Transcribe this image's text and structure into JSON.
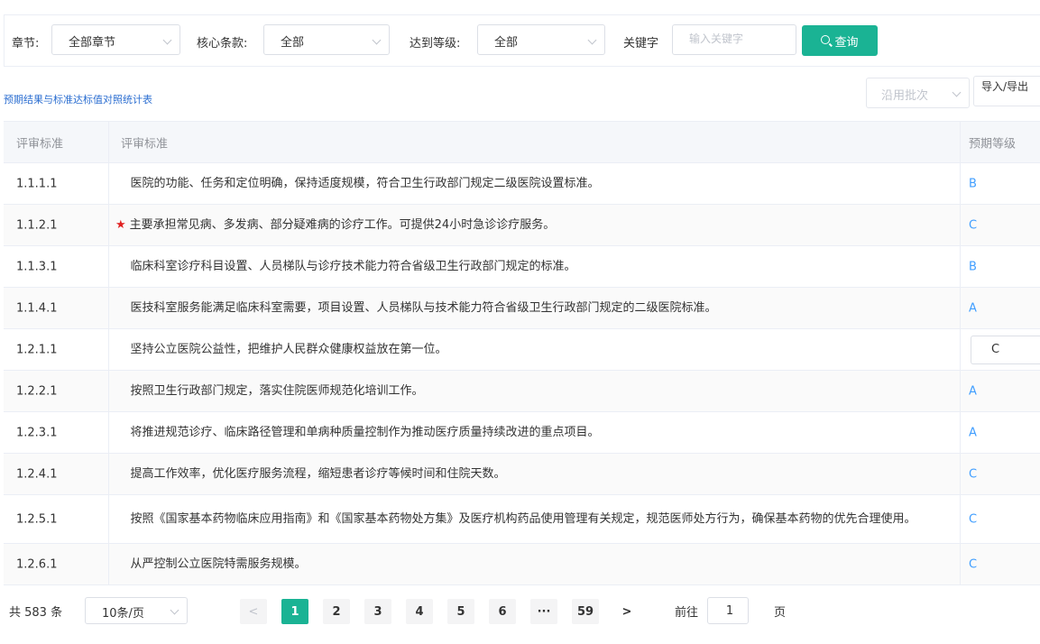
{
  "filters": {
    "chapter_label": "章节:",
    "chapter_value": "全部章节",
    "core_label": "核心条款:",
    "core_value": "全部",
    "level_label": "达到等级:",
    "level_value": "全部",
    "keyword_label": "关键字",
    "keyword_placeholder": "输入关键字",
    "query_label": "查询"
  },
  "toolbar": {
    "report_link": "预期结果与标准达标值对照统计表",
    "batch_placeholder": "沿用批次",
    "io_label": "导入/导出"
  },
  "table": {
    "headers": [
      "评审标准",
      "评审标准",
      "预期等级"
    ],
    "rows": [
      {
        "code": "1.1.1.1",
        "star": false,
        "text": "医院的功能、任务和定位明确，保持适度规模，符合卫生行政部门规定二级医院设置标准。",
        "grade": "B"
      },
      {
        "code": "1.1.2.1",
        "star": true,
        "text": "主要承担常见病、多发病、部分疑难病的诊疗工作。可提供24小时急诊诊疗服务。",
        "grade": "C"
      },
      {
        "code": "1.1.3.1",
        "star": false,
        "text": "临床科室诊疗科目设置、人员梯队与诊疗技术能力符合省级卫生行政部门规定的标准。",
        "grade": "B"
      },
      {
        "code": "1.1.4.1",
        "star": false,
        "text": "医技科室服务能满足临床科室需要，项目设置、人员梯队与技术能力符合省级卫生行政部门规定的二级医院标准。",
        "grade": "A"
      },
      {
        "code": "1.2.1.1",
        "star": false,
        "text": "坚持公立医院公益性，把维护人民群众健康权益放在第一位。",
        "grade": "C",
        "editing": true
      },
      {
        "code": "1.2.2.1",
        "star": false,
        "text": "按照卫生行政部门规定，落实住院医师规范化培训工作。",
        "grade": "A"
      },
      {
        "code": "1.2.3.1",
        "star": false,
        "text": "将推进规范诊疗、临床路径管理和单病种质量控制作为推动医疗质量持续改进的重点项目。",
        "grade": "A"
      },
      {
        "code": "1.2.4.1",
        "star": false,
        "text": "提高工作效率，优化医疗服务流程，缩短患者诊疗等候时间和住院天数。",
        "grade": "C"
      },
      {
        "code": "1.2.5.1",
        "star": false,
        "text": "按照《国家基本药物临床应用指南》和《国家基本药物处方集》及医疗机构药品使用管理有关规定，规范医师处方行为，确保基本药物的优先合理使用。",
        "grade": "C"
      },
      {
        "code": "1.2.6.1",
        "star": false,
        "text": "从严控制公立医院特需服务规模。",
        "grade": "C"
      }
    ]
  },
  "pagination": {
    "total": "共 583 条",
    "page_size": "10条/页",
    "prev": "<",
    "pages": [
      "1",
      "2",
      "3",
      "4",
      "5",
      "6",
      "···",
      "59"
    ],
    "next": ">",
    "goto_label": "前往",
    "goto_value": "1",
    "page_suffix": "页"
  },
  "colors": {
    "accent": "#1ab394",
    "grade": "#409eff",
    "link": "#2d6fd1",
    "star": "#e02020"
  }
}
